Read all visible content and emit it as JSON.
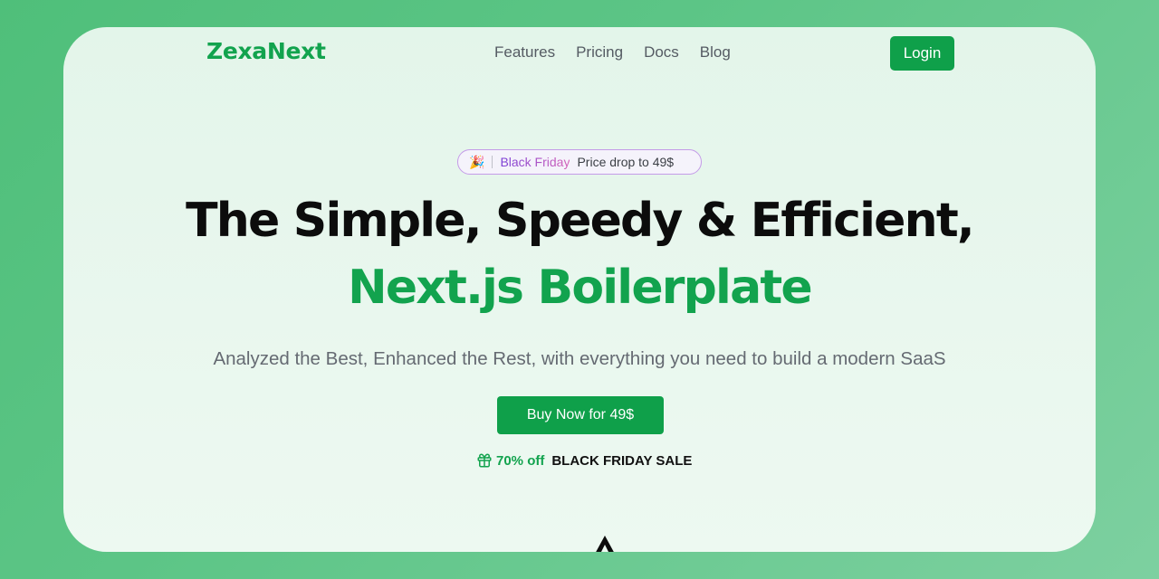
{
  "header": {
    "logo": "ZexaNext",
    "nav": [
      "Features",
      "Pricing",
      "Docs",
      "Blog"
    ],
    "login_label": "Login"
  },
  "badge": {
    "icon": "party-popper-icon",
    "highlight": "Black Friday",
    "text": "Price drop to 49$"
  },
  "hero": {
    "title_line1": "The Simple, Speedy & Efficient,",
    "title_line2": "Next.js Boilerplate",
    "subtitle": "Analyzed the Best, Enhanced the Rest, with everything you need to build a modern SaaS",
    "cta_label": "Buy Now for 49$"
  },
  "sale": {
    "icon": "gift-icon",
    "discount": "70% off",
    "label": "BLACK FRIDAY SALE"
  },
  "colors": {
    "brand": "#12a34e",
    "button": "#0fa04a",
    "badge_gradient_start": "#7a3fd6",
    "badge_gradient_end": "#d464b9"
  }
}
